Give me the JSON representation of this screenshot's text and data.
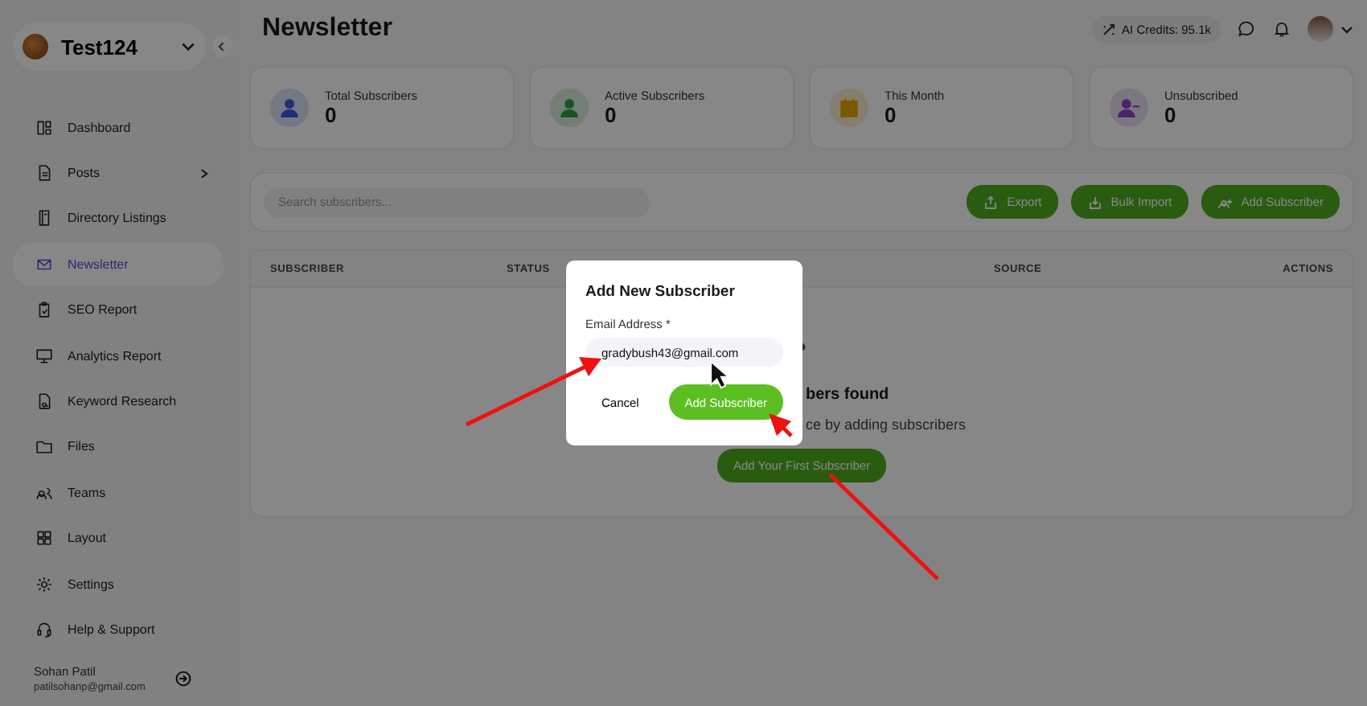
{
  "workspace": {
    "name": "Test124"
  },
  "sidebar": {
    "items": [
      {
        "label": "Dashboard",
        "selected": false,
        "has_submenu": false
      },
      {
        "label": "Posts",
        "selected": false,
        "has_submenu": true
      },
      {
        "label": "Directory Listings",
        "selected": false,
        "has_submenu": false
      },
      {
        "label": "Newsletter",
        "selected": true,
        "has_submenu": false
      },
      {
        "label": "SEO Report",
        "selected": false,
        "has_submenu": false
      },
      {
        "label": "Analytics Report",
        "selected": false,
        "has_submenu": false
      },
      {
        "label": "Keyword Research",
        "selected": false,
        "has_submenu": false
      },
      {
        "label": "Files",
        "selected": false,
        "has_submenu": false
      },
      {
        "label": "Teams",
        "selected": false,
        "has_submenu": false
      },
      {
        "label": "Layout",
        "selected": false,
        "has_submenu": false
      },
      {
        "label": "Settings",
        "selected": false,
        "has_submenu": false
      },
      {
        "label": "Help & Support",
        "selected": false,
        "has_submenu": false
      }
    ],
    "user": {
      "name": "Sohan Patil",
      "email": "patilsohanp@gmail.com"
    }
  },
  "header": {
    "title": "Newsletter",
    "credits": "AI Credits: 95.1k"
  },
  "stats": [
    {
      "label": "Total Subscribers",
      "value": "0"
    },
    {
      "label": "Active Subscribers",
      "value": "0"
    },
    {
      "label": "This Month",
      "value": "0"
    },
    {
      "label": "Unsubscribed",
      "value": "0"
    }
  ],
  "toolbar": {
    "search_placeholder": "Search subscribers...",
    "buttons": [
      "Export",
      "Bulk Import",
      "Add Subscriber"
    ]
  },
  "table": {
    "columns": [
      "SUBSCRIBER",
      "STATUS",
      "SOURCE",
      "ACTIONS"
    ],
    "empty_title": "bers found",
    "empty_text": "ce by adding subscribers",
    "empty_button": "Add Your First Subscriber"
  },
  "dialog": {
    "title": "Add New Subscriber",
    "field_label": "Email Address *",
    "field_value": "gradybush43@gmail.com",
    "cancel": "Cancel",
    "submit": "Add Subscriber"
  }
}
